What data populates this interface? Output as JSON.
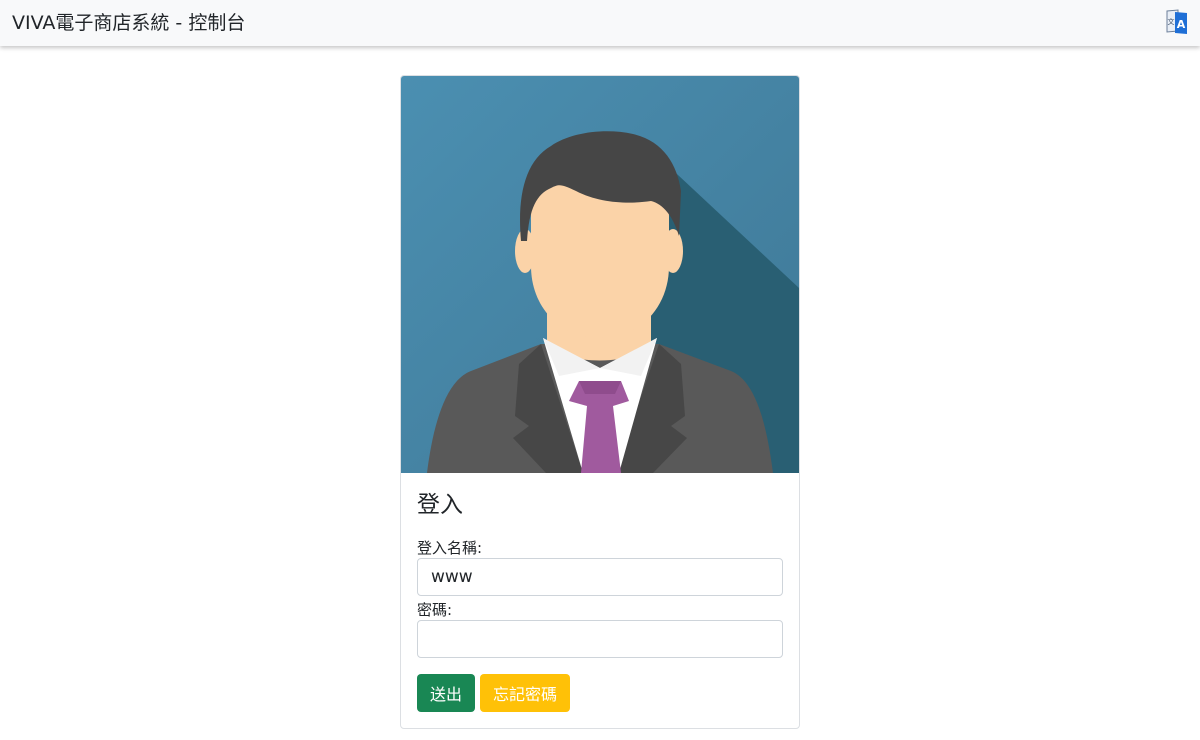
{
  "navbar": {
    "brand": "VIVA電子商店系統 - 控制台",
    "translate_icon": "translate-icon"
  },
  "login_card": {
    "avatar_icon": "businessman-avatar",
    "title": "登入",
    "username_label": "登入名稱:",
    "username_value": "www",
    "password_label": "密碼:",
    "password_value": "",
    "submit_label": "送出",
    "forgot_label": "忘記密碼"
  },
  "colors": {
    "navbar_bg": "#f8f9fa",
    "submit": "#198754",
    "forgot": "#ffc107",
    "avatar_bg": "#4a8aab",
    "tie": "#a05a9e"
  }
}
